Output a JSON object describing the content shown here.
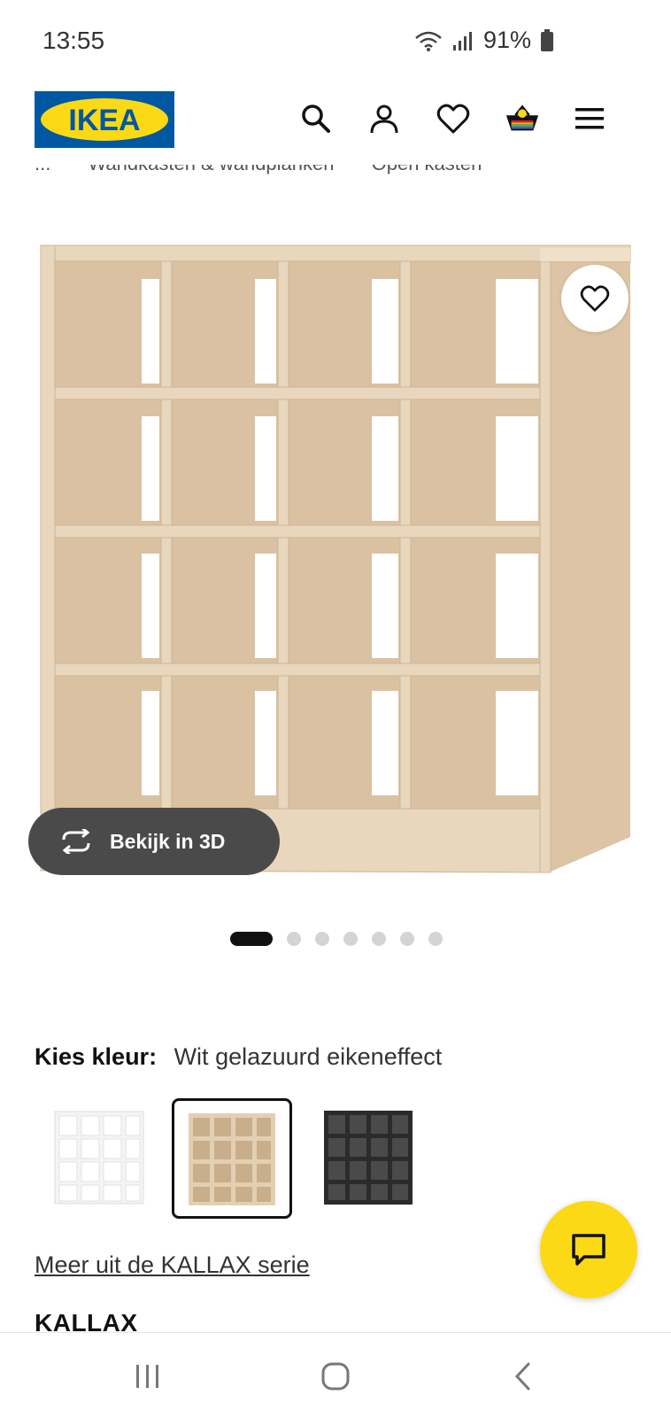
{
  "status_bar": {
    "time": "13:55",
    "battery": "91%",
    "icons": [
      "wifi-icon",
      "signal-icon",
      "battery-icon"
    ]
  },
  "header": {
    "logo_text": "IKEA",
    "icons": [
      "search-icon",
      "account-icon",
      "favorites-icon",
      "basket-icon",
      "menu-icon"
    ]
  },
  "breadcrumb": [
    "...",
    "Wandkasten & wandplanken",
    "Open kasten"
  ],
  "product_image": {
    "view_3d_label": "Bekijk in 3D",
    "total_images": 7,
    "active_image": 1
  },
  "color": {
    "label": "Kies kleur:",
    "selected": "Wit gelazuurd eikeneffect",
    "options": [
      "white",
      "white-stained-oak",
      "black-brown"
    ],
    "selected_index": 1
  },
  "series_link": "Meer uit de KALLAX serie",
  "product_name": "KALLAX",
  "colors": {
    "brand_blue": "#0058a3",
    "brand_yellow": "#fbd914",
    "chat_yellow": "#fbd914",
    "wood": "#e8d6bd"
  }
}
